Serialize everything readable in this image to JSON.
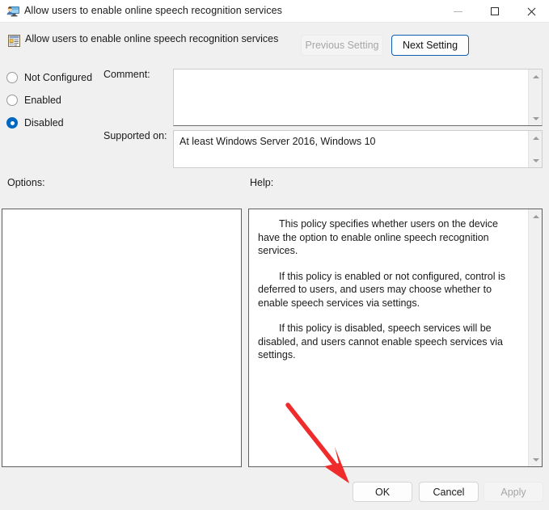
{
  "window": {
    "title": "Allow users to enable online speech recognition services",
    "icon": "group-policy-computer-icon",
    "controls": {
      "minimize": "—",
      "maximize": "□",
      "close": "✕"
    }
  },
  "header": {
    "icon": "policy-setting-icon",
    "title": "Allow users to enable online speech recognition services",
    "previous_setting_label": "Previous Setting",
    "previous_setting_enabled": false,
    "next_setting_label": "Next Setting",
    "next_setting_enabled": true
  },
  "state_options": {
    "selected": "Disabled",
    "items": [
      {
        "label": "Not Configured",
        "checked": false
      },
      {
        "label": "Enabled",
        "checked": false
      },
      {
        "label": "Disabled",
        "checked": true
      }
    ]
  },
  "fields": {
    "comment_label": "Comment:",
    "comment_value": "",
    "supported_on_label": "Supported on:",
    "supported_on_value": "At least Windows Server 2016, Windows 10"
  },
  "panels": {
    "options_label": "Options:",
    "options_content": "",
    "help_label": "Help:",
    "help_paragraphs": [
      "This policy specifies whether users on the device have the option to enable online speech recognition services.",
      "If this policy is enabled or not configured, control is deferred to users, and users may choose whether to enable speech services via settings.",
      "If this policy is disabled, speech services will be disabled, and users cannot enable speech services via settings."
    ]
  },
  "footer": {
    "ok_label": "OK",
    "cancel_label": "Cancel",
    "apply_label": "Apply",
    "apply_enabled": false
  },
  "annotation": {
    "type": "arrow",
    "color": "#ef2b2b",
    "points_to": "ok-button"
  },
  "icons": {
    "scroll_up": "scroll-up-arrow-icon",
    "scroll_down": "scroll-down-arrow-icon"
  }
}
